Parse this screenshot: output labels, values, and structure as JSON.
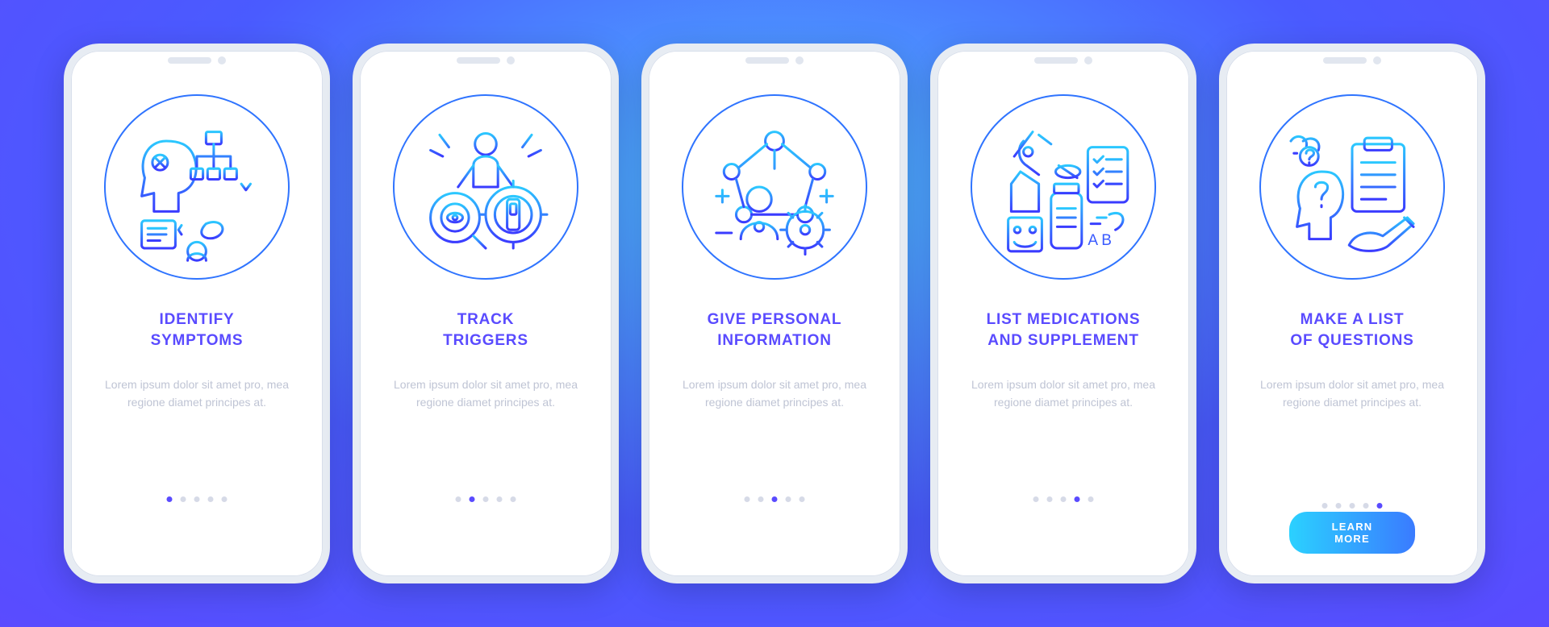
{
  "body_text": "Lorem ipsum dolor sit amet pro, mea regione diamet principes at.",
  "cta_label": "LEARN MORE",
  "total_slides": 5,
  "screens": [
    {
      "title": "IDENTIFY\nSYMPTOMS",
      "icon": "identify-symptoms-icon",
      "active_index": 0,
      "has_cta": false
    },
    {
      "title": "TRACK\nTRIGGERS",
      "icon": "track-triggers-icon",
      "active_index": 1,
      "has_cta": false
    },
    {
      "title": "GIVE PERSONAL\nINFORMATION",
      "icon": "personal-info-icon",
      "active_index": 2,
      "has_cta": false
    },
    {
      "title": "LIST MEDICATIONS\nAND SUPPLEMENT",
      "icon": "medications-icon",
      "active_index": 3,
      "has_cta": false
    },
    {
      "title": "MAKE A LIST\nOF QUESTIONS",
      "icon": "questions-list-icon",
      "active_index": 4,
      "has_cta": true
    }
  ]
}
